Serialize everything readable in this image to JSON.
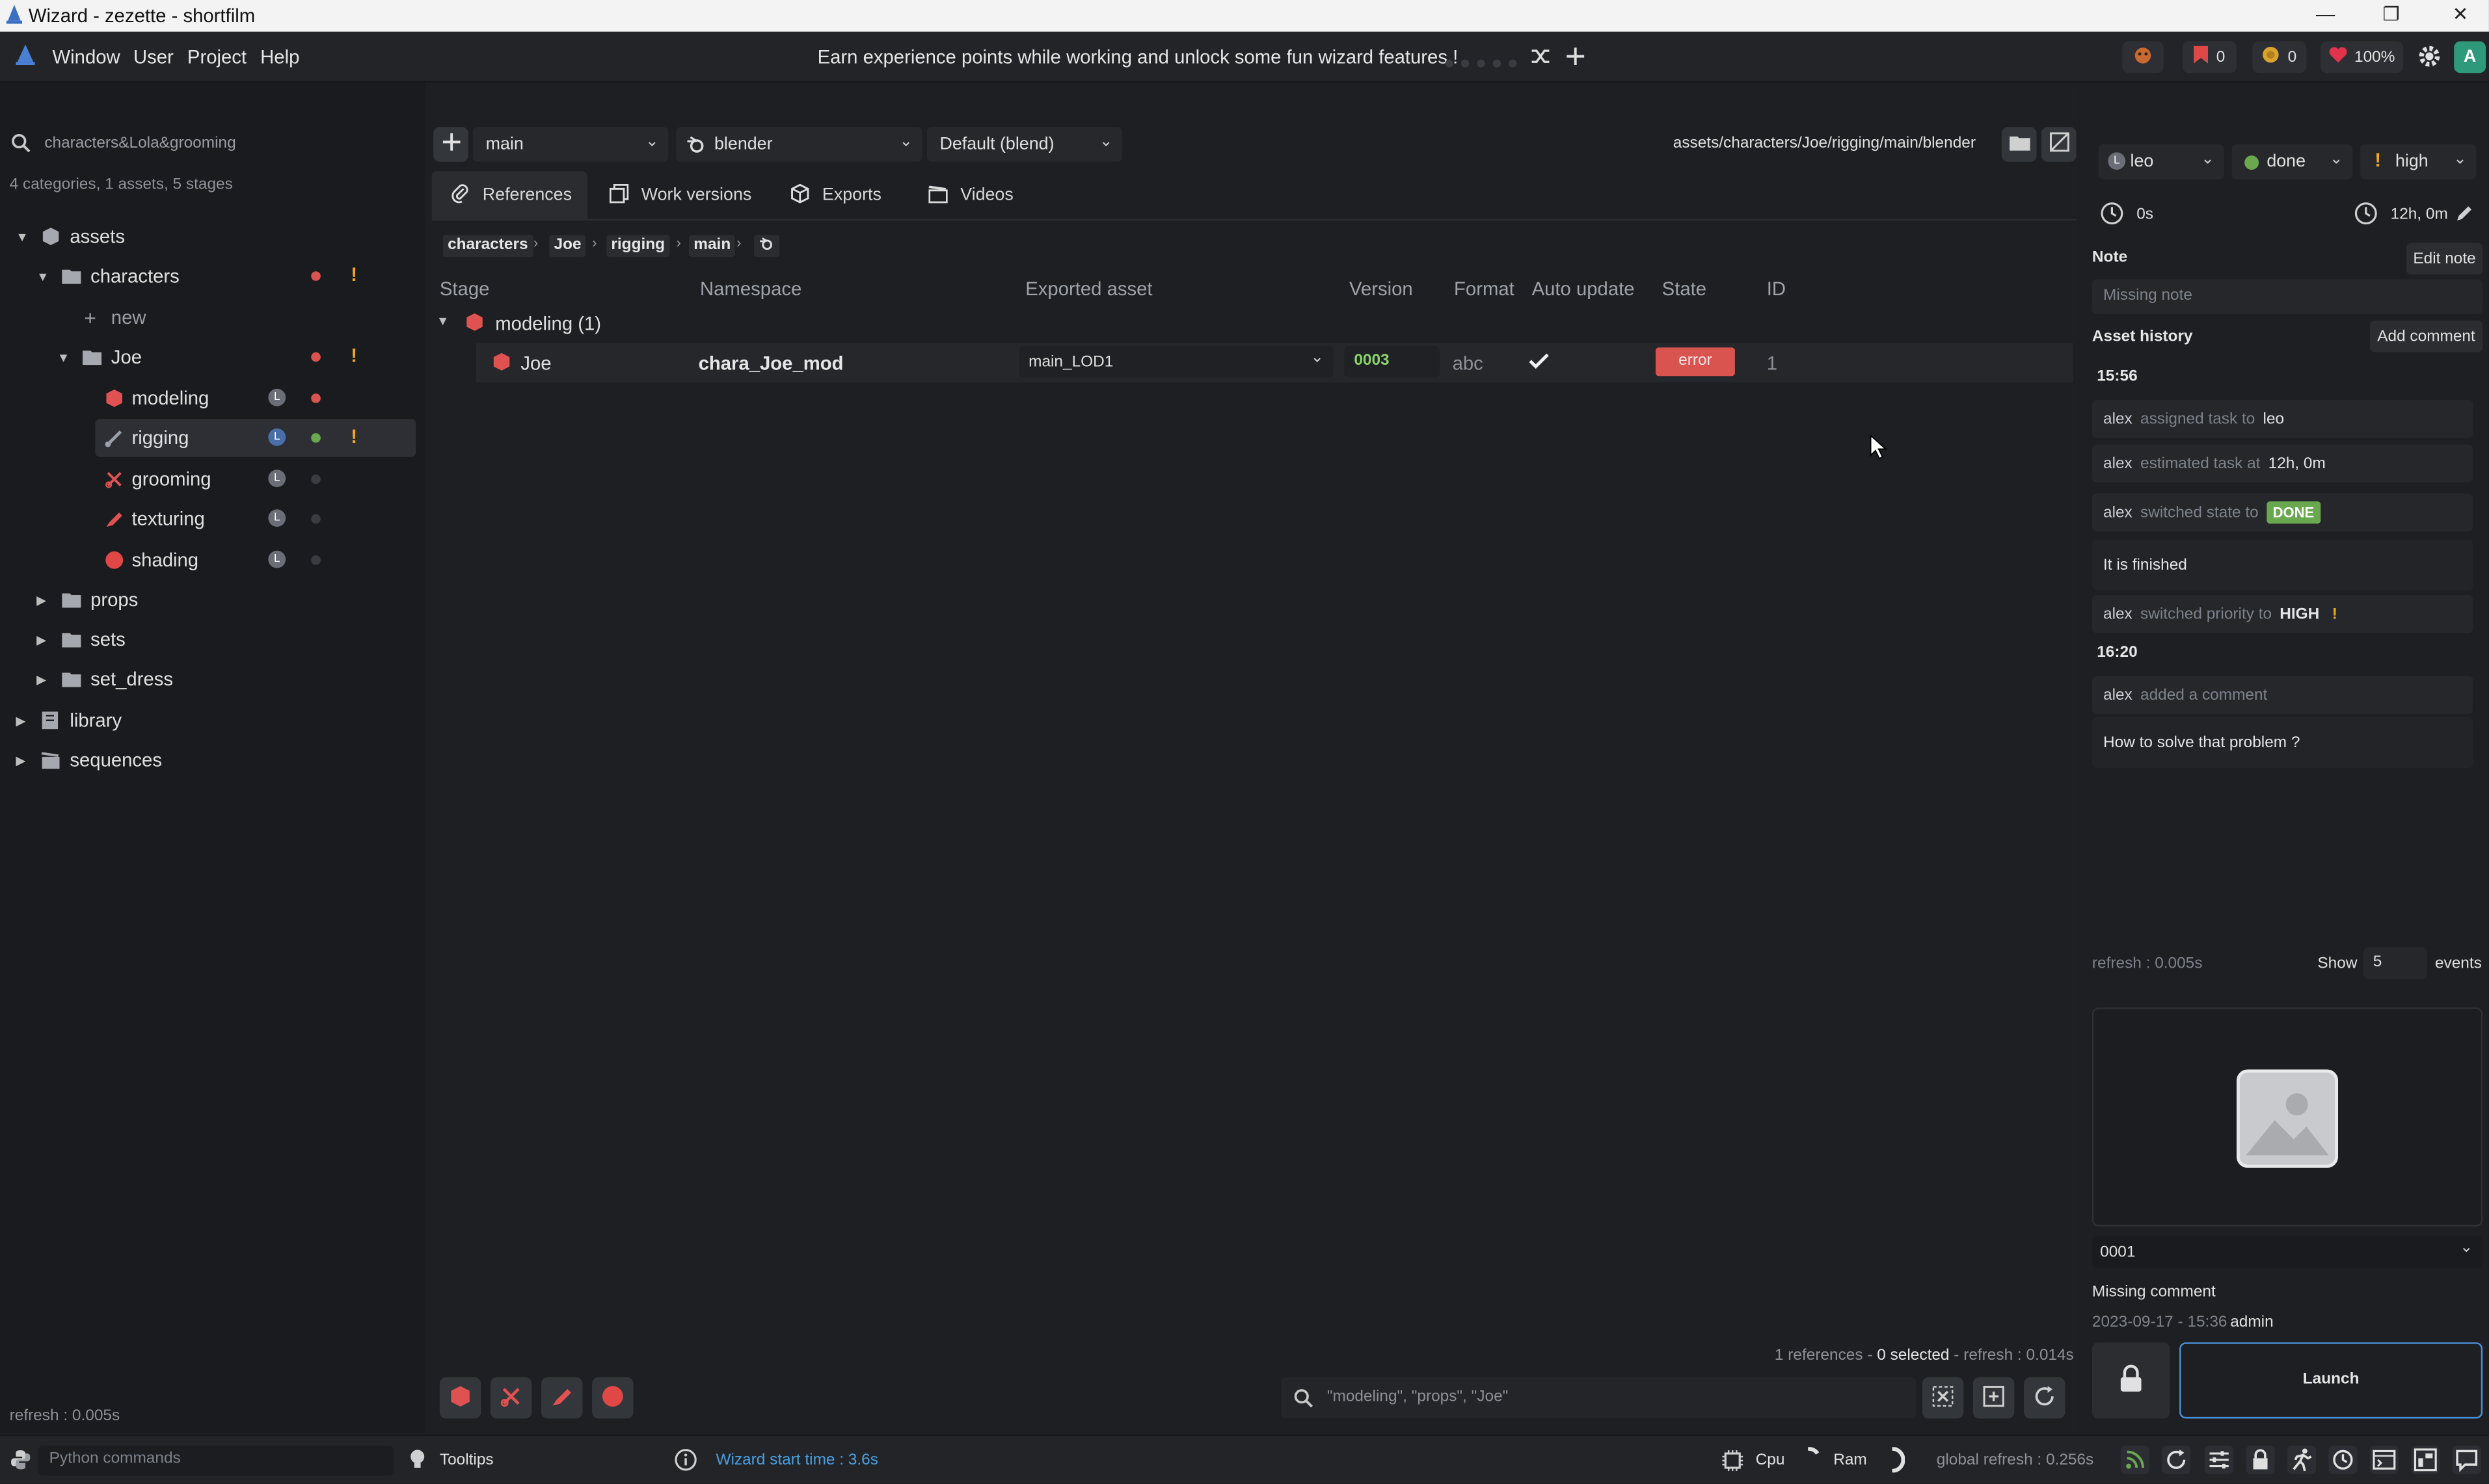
{
  "window": {
    "title": "Wizard - zezette - shortfilm",
    "minimize": "—",
    "maximize": "❐",
    "close": "✕"
  },
  "menu": {
    "items": [
      "Window",
      "User",
      "Project",
      "Help"
    ],
    "banner": "Earn experience points while working and unlock some fun wizard features !",
    "stats": {
      "bookmarks": "0",
      "coins": "0",
      "health": "100%",
      "user_initial": "A"
    }
  },
  "sidebar": {
    "search_value": "characters&Lola&grooming",
    "summary": "4 categories, 1 assets, 5 stages",
    "tree": {
      "assets": "assets",
      "characters": "characters",
      "new": "new",
      "joe": "Joe",
      "modeling": "modeling",
      "rigging": "rigging",
      "grooming": "grooming",
      "texturing": "texturing",
      "shading": "shading",
      "props": "props",
      "sets": "sets",
      "set_dress": "set_dress",
      "library": "library",
      "sequences": "sequences"
    },
    "avatar_letter": "L",
    "refresh": "refresh : 0.005s"
  },
  "toolbar": {
    "variant": "main",
    "software": "blender",
    "export_type": "Default (blend)",
    "path": "assets/characters/Joe/rigging/main/blender"
  },
  "tabs": [
    "References",
    "Work versions",
    "Exports",
    "Videos"
  ],
  "breadcrumb": [
    "characters",
    "Joe",
    "rigging",
    "main"
  ],
  "table": {
    "headers": [
      "Stage",
      "Namespace",
      "Exported asset",
      "Version",
      "Format",
      "Auto update",
      "State",
      "ID"
    ],
    "group": "modeling (1)",
    "row": {
      "stage": "Joe",
      "namespace": "chara_Joe_mod",
      "exported_asset": "main_LOD1",
      "version": "0003",
      "format": "abc",
      "state": "error",
      "id": "1"
    }
  },
  "footer_center": {
    "refs": "1 references - ",
    "selected": "0 selected",
    "refresh": " - refresh : 0.014s",
    "search_placeholder": "\"modeling\", \"props\", \"Joe\""
  },
  "right": {
    "assignee": "leo",
    "state": "done",
    "priority": "high",
    "time_spent": "0s",
    "estimate": "12h, 0m",
    "note_label": "Note",
    "edit_note": "Edit note",
    "note_placeholder": "Missing note",
    "history_label": "Asset history",
    "add_comment": "Add comment",
    "time1": "15:56",
    "time2": "16:20",
    "events": [
      {
        "who": "alex",
        "action": "assigned task to",
        "value": "leo"
      },
      {
        "who": "alex",
        "action": "estimated task at",
        "value": "12h, 0m"
      },
      {
        "who": "alex",
        "action": "switched state to",
        "value": "DONE"
      },
      {
        "comment": "It is finished"
      },
      {
        "who": "alex",
        "action": "switched priority to",
        "value": "HIGH"
      },
      {
        "who": "alex",
        "action": "added a comment",
        "value": ""
      },
      {
        "comment": "How to solve that problem ?"
      }
    ],
    "refresh": "refresh : 0.005s",
    "show_label": "Show",
    "show_count": "5",
    "events_label": "events",
    "version_select": "0001",
    "version_comment": "Missing comment",
    "version_date": "2023-09-17 - 15:36",
    "version_user": "admin",
    "launch": "Launch"
  },
  "status": {
    "python_placeholder": "Python commands",
    "tooltips": "Tooltips",
    "start_time": "Wizard start time : 3.6s",
    "cpu": "Cpu",
    "ram": "Ram",
    "global_refresh": "global refresh : 0.256s"
  },
  "colors": {
    "accent": "#4a90d9",
    "error": "#d9534f",
    "done": "#6aa84f",
    "warn": "#f5a623",
    "modeling": "#e05252"
  }
}
